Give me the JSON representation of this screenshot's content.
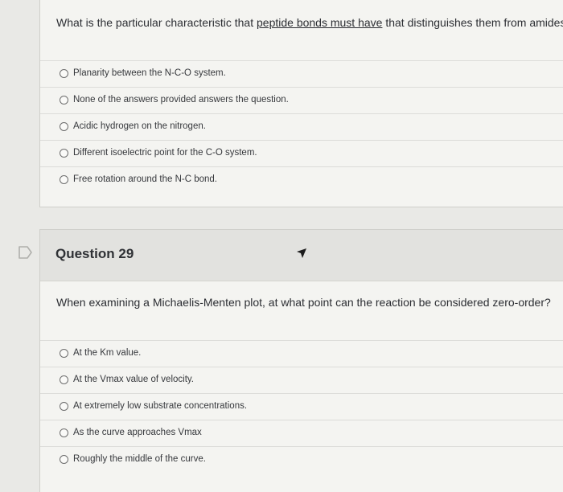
{
  "question28": {
    "prefix": "What is the particular characteristic that ",
    "underlined": "peptide bonds must have",
    "suffix": " that distinguishes them from amides?",
    "options": [
      "Planarity between the N-C-O system.",
      "None of the answers provided answers the question.",
      "Acidic hydrogen on the nitrogen.",
      "Different isoelectric point for the C-O system.",
      "Free rotation around the N-C bond."
    ]
  },
  "question29": {
    "title": "Question 29",
    "text": "When examining a Michaelis-Menten plot, at what point can the reaction be considered zero-order?",
    "options": [
      "At the Km value.",
      "At the Vmax value of velocity.",
      "At extremely low substrate concentrations.",
      "As the curve approaches Vmax",
      "Roughly the middle of the curve."
    ]
  },
  "icons": {
    "flag": "flag-icon",
    "cursor": "mouse-pointer-icon",
    "radio": "radio-button-icon"
  },
  "colors": {
    "background": "#e9e9e6",
    "card": "#f4f4f1",
    "header": "#e2e2df"
  }
}
